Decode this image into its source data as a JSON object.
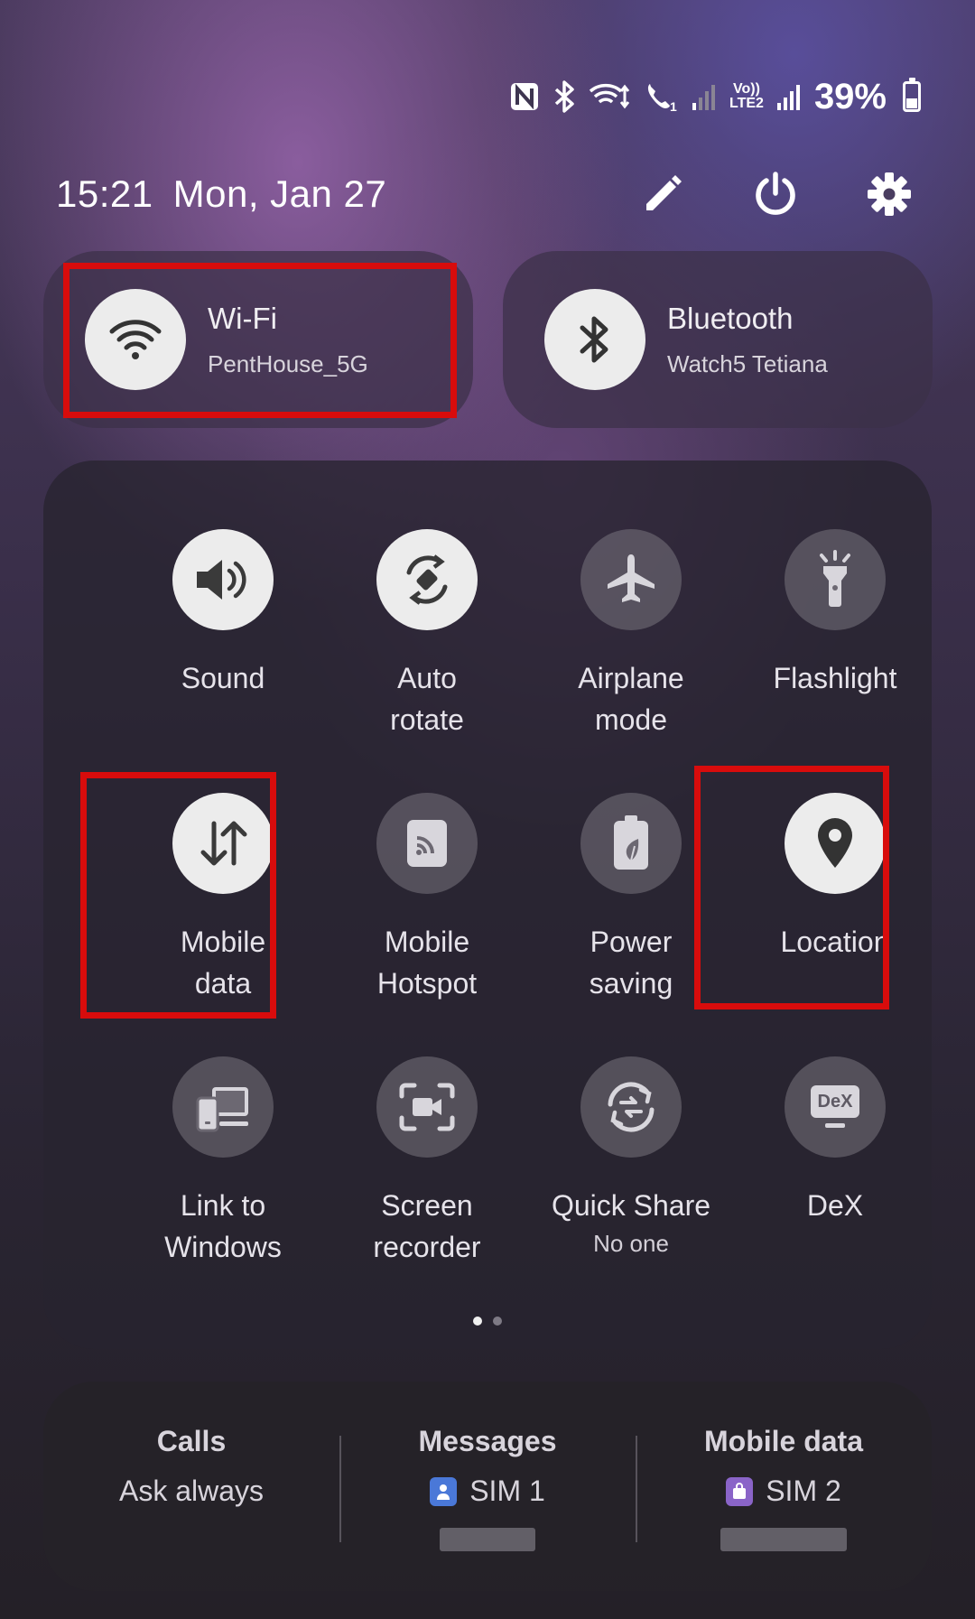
{
  "status_bar": {
    "battery_percent": "39%",
    "icons": [
      "nfc-icon",
      "bluetooth-icon",
      "wifi-calling-icon",
      "vowifi-call-icon",
      "signal-icon",
      "volte-lte2-icon",
      "signal-icon",
      "battery-icon"
    ],
    "lte_label_top": "Vo))",
    "lte_label_bottom": "LTE2"
  },
  "header": {
    "time": "15:21",
    "date": "Mon, Jan 27",
    "actions": [
      "edit-icon",
      "power-icon",
      "settings-icon"
    ]
  },
  "wifi_tile": {
    "title": "Wi-Fi",
    "subtitle": "PentHouse_5G",
    "active": true
  },
  "bluetooth_tile": {
    "title": "Bluetooth",
    "subtitle": "Watch5 Tetiana",
    "active": true
  },
  "tiles": [
    {
      "id": "sound",
      "label": "Sound",
      "icon": "sound-icon",
      "active": true
    },
    {
      "id": "auto-rotate",
      "label": "Auto\nrotate",
      "icon": "auto-rotate-icon",
      "active": true
    },
    {
      "id": "airplane",
      "label": "Airplane\nmode",
      "icon": "airplane-icon",
      "active": false
    },
    {
      "id": "flashlight",
      "label": "Flashlight",
      "icon": "flashlight-icon",
      "active": false
    },
    {
      "id": "mobile-data",
      "label": "Mobile\ndata",
      "icon": "mobile-data-icon",
      "active": true
    },
    {
      "id": "hotspot",
      "label": "Mobile\nHotspot",
      "icon": "hotspot-icon",
      "active": false
    },
    {
      "id": "power-saving",
      "label": "Power\nsaving",
      "icon": "power-saving-icon",
      "active": false
    },
    {
      "id": "location",
      "label": "Location",
      "icon": "location-icon",
      "active": true
    },
    {
      "id": "link-windows",
      "label": "Link to\nWindows",
      "icon": "link-to-windows-icon",
      "active": false
    },
    {
      "id": "screen-recorder",
      "label": "Screen\nrecorder",
      "icon": "screen-recorder-icon",
      "active": false
    },
    {
      "id": "quick-share",
      "label": "Quick Share",
      "sublabel": "No one",
      "icon": "quick-share-icon",
      "active": false
    },
    {
      "id": "dex",
      "label": "DeX",
      "icon": "dex-icon",
      "active": false,
      "icon_text": "DeX"
    }
  ],
  "pagination": {
    "pages": 2,
    "current": 1
  },
  "sim": {
    "calls": {
      "title": "Calls",
      "value": "Ask always"
    },
    "messages": {
      "title": "Messages",
      "value": "SIM 1",
      "badge_color": "#4a78d8"
    },
    "mobile_data": {
      "title": "Mobile data",
      "value": "SIM 2",
      "badge_color": "#8a64c8"
    }
  },
  "highlight_color": "#d80c0c"
}
